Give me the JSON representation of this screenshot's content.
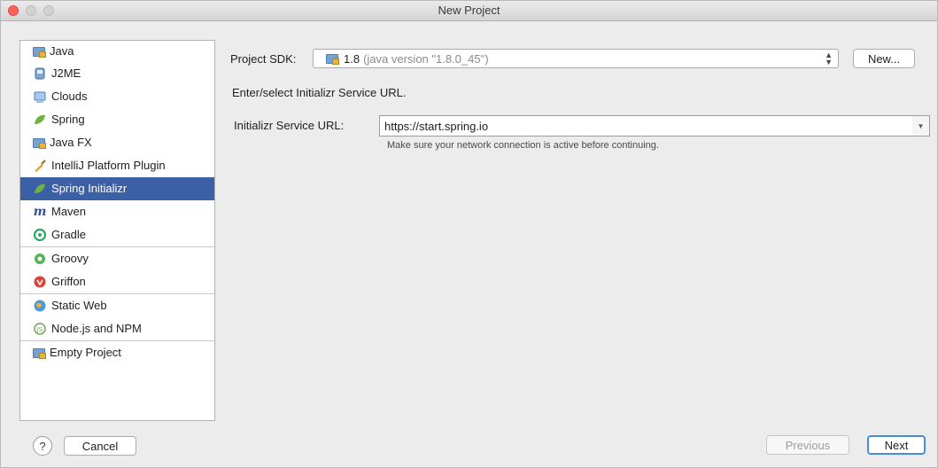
{
  "window": {
    "title": "New Project"
  },
  "sidebar": {
    "groups": [
      [
        {
          "label": "Java",
          "icon": "java-folder-icon"
        },
        {
          "label": "J2ME",
          "icon": "j2me-icon"
        },
        {
          "label": "Clouds",
          "icon": "clouds-icon"
        },
        {
          "label": "Spring",
          "icon": "spring-leaf-icon"
        },
        {
          "label": "Java FX",
          "icon": "javafx-folder-icon"
        },
        {
          "label": "IntelliJ Platform Plugin",
          "icon": "plugin-icon"
        },
        {
          "label": "Spring Initializr",
          "icon": "spring-initializr-icon",
          "selected": true
        },
        {
          "label": "Maven",
          "icon": "maven-icon"
        },
        {
          "label": "Gradle",
          "icon": "gradle-icon"
        }
      ],
      [
        {
          "label": "Groovy",
          "icon": "groovy-icon"
        },
        {
          "label": "Griffon",
          "icon": "griffon-icon"
        }
      ],
      [
        {
          "label": "Static Web",
          "icon": "static-web-icon"
        },
        {
          "label": "Node.js and NPM",
          "icon": "nodejs-icon"
        }
      ],
      [
        {
          "label": "Empty Project",
          "icon": "empty-project-icon"
        }
      ]
    ]
  },
  "main": {
    "sdk_label": "Project SDK:",
    "sdk_value": "1.8",
    "sdk_detail": "(java version \"1.8.0_45\")",
    "new_button": "New...",
    "instruction": "Enter/select Initializr Service URL.",
    "url_label": "Initializr Service URL:",
    "url_value": "https://start.spring.io",
    "hint": "Make sure your network connection is active before continuing."
  },
  "footer": {
    "help": "?",
    "cancel": "Cancel",
    "previous": "Previous",
    "next": "Next"
  },
  "colors": {
    "selection": "#3b60a5",
    "next_border": "#4a8be0",
    "close_button": "#fc615d"
  }
}
